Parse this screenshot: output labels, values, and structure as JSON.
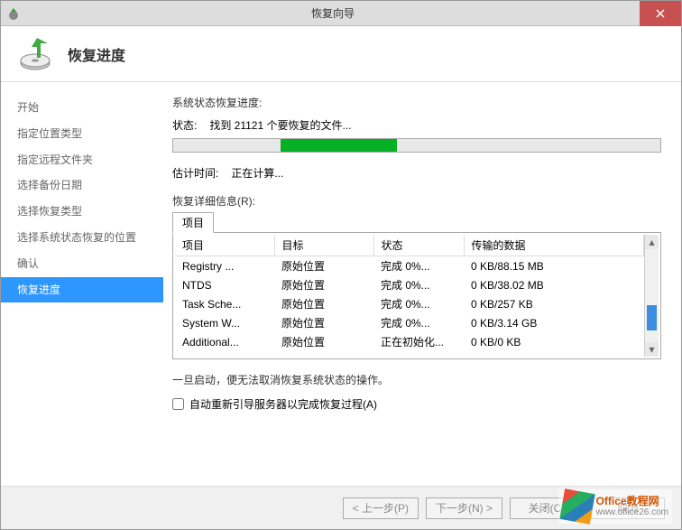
{
  "window": {
    "title": "恢复向导"
  },
  "header": {
    "title": "恢复进度"
  },
  "sidebar": {
    "items": [
      {
        "label": "开始"
      },
      {
        "label": "指定位置类型"
      },
      {
        "label": "指定远程文件夹"
      },
      {
        "label": "选择备份日期"
      },
      {
        "label": "选择恢复类型"
      },
      {
        "label": "选择系统状态恢复的位置"
      },
      {
        "label": "确认"
      },
      {
        "label": "恢复进度"
      }
    ],
    "active_index": 7
  },
  "main": {
    "progress_label": "系统状态恢复进度:",
    "status_label": "状态:",
    "status_value": "找到 21121 个要恢复的文件...",
    "progress_percent_left": 22,
    "progress_percent_width": 24,
    "eta_label": "估计时间:",
    "eta_value": "正在计算...",
    "details_label": "恢复详细信息(R):",
    "tab_label": "项目",
    "columns": [
      "项目",
      "目标",
      "状态",
      "传输的数据"
    ],
    "rows": [
      {
        "c0": "Registry ...",
        "c1": "原始位置",
        "c2": "完成 0%...",
        "c3": "0 KB/88.15 MB"
      },
      {
        "c0": "NTDS",
        "c1": "原始位置",
        "c2": "完成 0%...",
        "c3": "0 KB/38.02 MB"
      },
      {
        "c0": "Task Sche...",
        "c1": "原始位置",
        "c2": "完成 0%...",
        "c3": "0 KB/257 KB"
      },
      {
        "c0": "System W...",
        "c1": "原始位置",
        "c2": "完成 0%...",
        "c3": "0 KB/3.14 GB"
      },
      {
        "c0": "Additional...",
        "c1": "原始位置",
        "c2": "正在初始化...",
        "c3": "0 KB/0 KB"
      }
    ],
    "notice": "一旦启动，便无法取消恢复系统状态的操作。",
    "checkbox_label": "自动重新引导服务器以完成恢复过程(A)"
  },
  "footer": {
    "prev": "< 上一步(P)",
    "next": "下一步(N) >",
    "close": "关闭(C)",
    "cancel": "取消"
  },
  "watermark": {
    "line1": "Office教程网",
    "line2": "www.office26.com"
  },
  "chart_data": {
    "type": "table",
    "title": "恢复详细信息",
    "columns": [
      "项目",
      "目标",
      "状态",
      "传输的数据"
    ],
    "rows": [
      [
        "Registry ...",
        "原始位置",
        "完成 0%...",
        "0 KB/88.15 MB"
      ],
      [
        "NTDS",
        "原始位置",
        "完成 0%...",
        "0 KB/38.02 MB"
      ],
      [
        "Task Sche...",
        "原始位置",
        "完成 0%...",
        "0 KB/257 KB"
      ],
      [
        "System W...",
        "原始位置",
        "完成 0%...",
        "0 KB/3.14 GB"
      ],
      [
        "Additional...",
        "原始位置",
        "正在初始化...",
        "0 KB/0 KB"
      ]
    ]
  }
}
